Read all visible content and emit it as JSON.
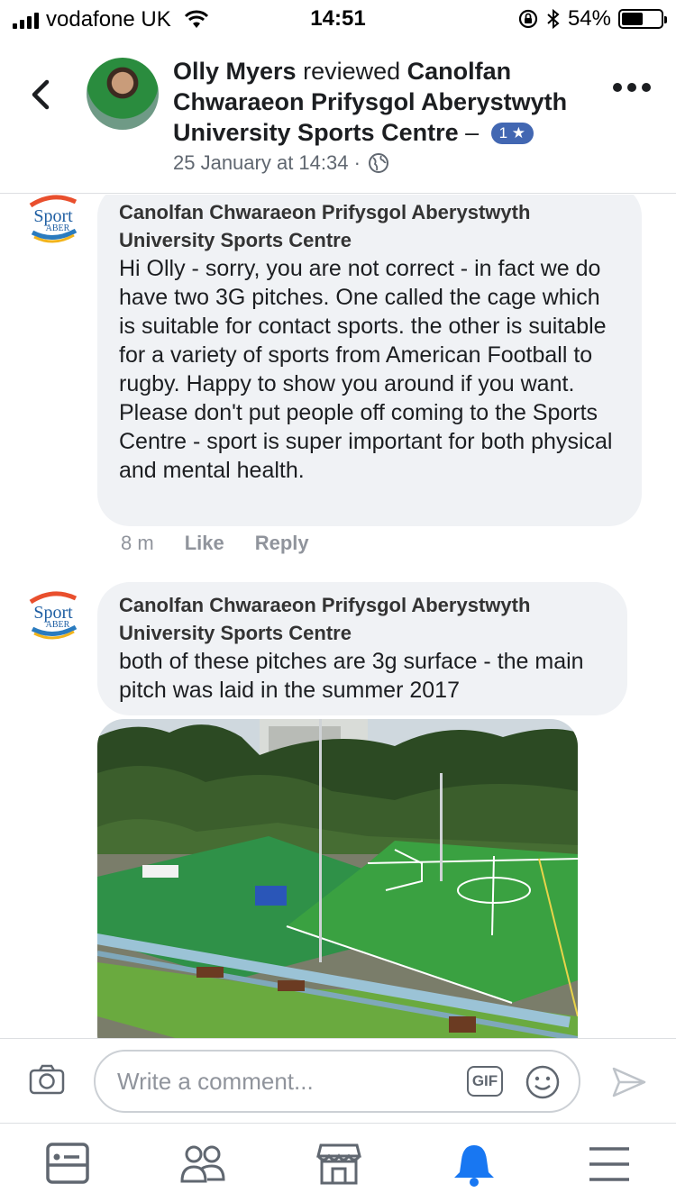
{
  "status_bar": {
    "carrier": "vodafone UK",
    "time": "14:51",
    "battery": "54%",
    "battery_level": 0.54
  },
  "header": {
    "reviewer": "Olly Myers",
    "action": " reviewed ",
    "place": "Canolfan Chwaraeon Prifysgol Aberystwyth University Sports Centre",
    "dash": " – ",
    "rating": "1 ★",
    "date": "25 January at 14:34 ·"
  },
  "comments": [
    {
      "author": "Canolfan Chwaraeon Prifysgol Aberystwyth University Sports Centre",
      "text": "Hi Olly - sorry, you are not correct - in fact we do have two 3G pitches. One called the cage which is suitable for contact sports. the other is suitable for a variety of  sports from American Football to rugby.  Happy to show you around if you want. Please don't put people off coming to the Sports Centre - sport is super important for both physical and mental health.",
      "time": "8 m",
      "like": "Like",
      "reply": "Reply"
    },
    {
      "author": "Canolfan Chwaraeon Prifysgol Aberystwyth University Sports Centre",
      "text": "both of these pitches are 3g surface - the main pitch was laid in the summer 2017"
    }
  ],
  "logo": {
    "top": "Sport",
    "bottom": "ABER"
  },
  "composer": {
    "placeholder": "Write a comment...",
    "gif": "GIF"
  },
  "colors": {
    "facebook_blue": "#4267b2",
    "bubble_bg": "#f0f2f5",
    "active_tab": "#1877f2",
    "meta_text": "#90949c"
  }
}
